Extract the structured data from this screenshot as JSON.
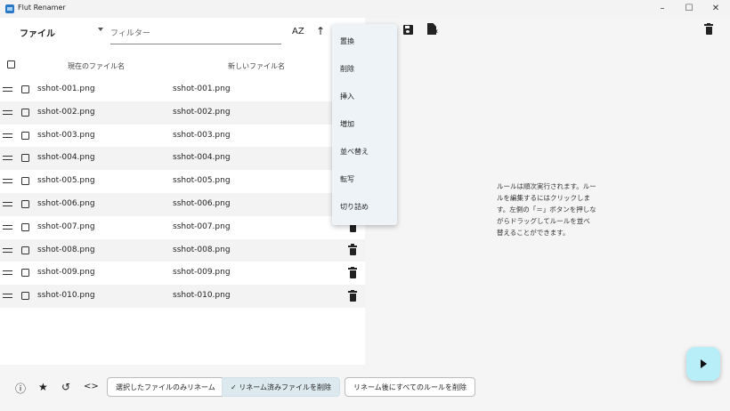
{
  "window": {
    "title": "Flut Renamer",
    "controls": {
      "minimize": "–",
      "maximize": "☐",
      "close": "✕"
    }
  },
  "toolbar": {
    "file_dropdown": "ファイル",
    "filter_placeholder": "フィルター",
    "sort_icon_label": "AZ",
    "up_icon_label": "↑"
  },
  "table": {
    "header_current": "現在のファイル名",
    "header_new": "新しいファイル名",
    "rows": [
      {
        "current": "sshot-001.png",
        "new": "sshot-001.png"
      },
      {
        "current": "sshot-002.png",
        "new": "sshot-002.png"
      },
      {
        "current": "sshot-003.png",
        "new": "sshot-003.png"
      },
      {
        "current": "sshot-004.png",
        "new": "sshot-004.png"
      },
      {
        "current": "sshot-005.png",
        "new": "sshot-005.png"
      },
      {
        "current": "sshot-006.png",
        "new": "sshot-006.png"
      },
      {
        "current": "sshot-007.png",
        "new": "sshot-007.png"
      },
      {
        "current": "sshot-008.png",
        "new": "sshot-008.png"
      },
      {
        "current": "sshot-009.png",
        "new": "sshot-009.png"
      },
      {
        "current": "sshot-010.png",
        "new": "sshot-010.png"
      }
    ]
  },
  "rule_menu": {
    "items": [
      "置換",
      "削除",
      "挿入",
      "増加",
      "並べ替え",
      "転写",
      "切り詰め"
    ]
  },
  "rules_panel": {
    "help_text": "ルールは順次実行されます。ルールを編集するにはクリックします。左側の「＝」ボタンを押しながらドラッグしてルールを並べ替えることができます。"
  },
  "bottombar": {
    "info_icon": "ⓘ",
    "star_icon": "★",
    "history_icon": "↺",
    "code_icon": "<>",
    "rename_selected_only": "選択したファイルのみリネーム",
    "remove_renamed_check": "✓",
    "remove_renamed": "リネーム済みファイルを削除",
    "remove_all_rules": "リネーム後にすべてのルールを削除"
  },
  "icons": {
    "sort": "sort-az-icon",
    "arrow_up": "arrow-up-icon",
    "save": "save-icon",
    "open_doc": "document-icon",
    "delete": "trash-icon",
    "run": "play-icon"
  }
}
